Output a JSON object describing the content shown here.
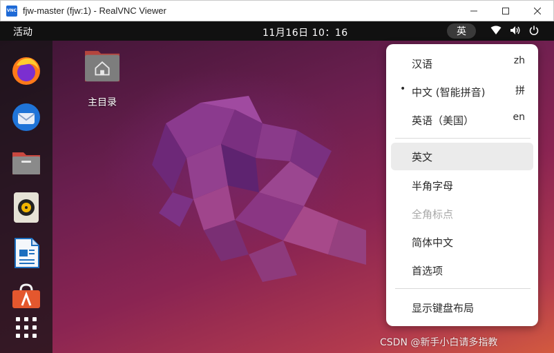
{
  "window": {
    "logo": "VNC",
    "title": "fjw-master (fjw:1) - RealVNC Viewer"
  },
  "topbar": {
    "activities": "活动",
    "clock": "11月16日  10：16",
    "ime_indicator": "英"
  },
  "desktop": {
    "home_folder_label": "主目录"
  },
  "dock": {
    "items": [
      "firefox-icon",
      "thunderbird-icon",
      "files-icon",
      "rhythmbox-icon",
      "libreoffice-writer-icon",
      "software-icon",
      "show-apps-icon"
    ]
  },
  "menu": {
    "languages": [
      {
        "label": "汉语",
        "short": "zh",
        "selected": false
      },
      {
        "label": "中文 (智能拼音)",
        "short": "拼",
        "selected": true
      },
      {
        "label": "英语（美国）",
        "short": "en",
        "selected": false
      }
    ],
    "selected_marker": "•",
    "options": [
      {
        "label": "英文",
        "hover": true,
        "disabled": false
      },
      {
        "label": "半角字母",
        "hover": false,
        "disabled": false
      },
      {
        "label": "全角标点",
        "hover": false,
        "disabled": true
      },
      {
        "label": "简体中文",
        "hover": false,
        "disabled": false
      },
      {
        "label": "首选项",
        "hover": false,
        "disabled": false
      }
    ],
    "show_layout": "显示键盘布局"
  },
  "watermark": "CSDN @新手小白请多指教",
  "colors": {
    "menu_hover": "#ebebeb",
    "topbar": "#111111",
    "disabled_text": "#a8a8a8"
  }
}
